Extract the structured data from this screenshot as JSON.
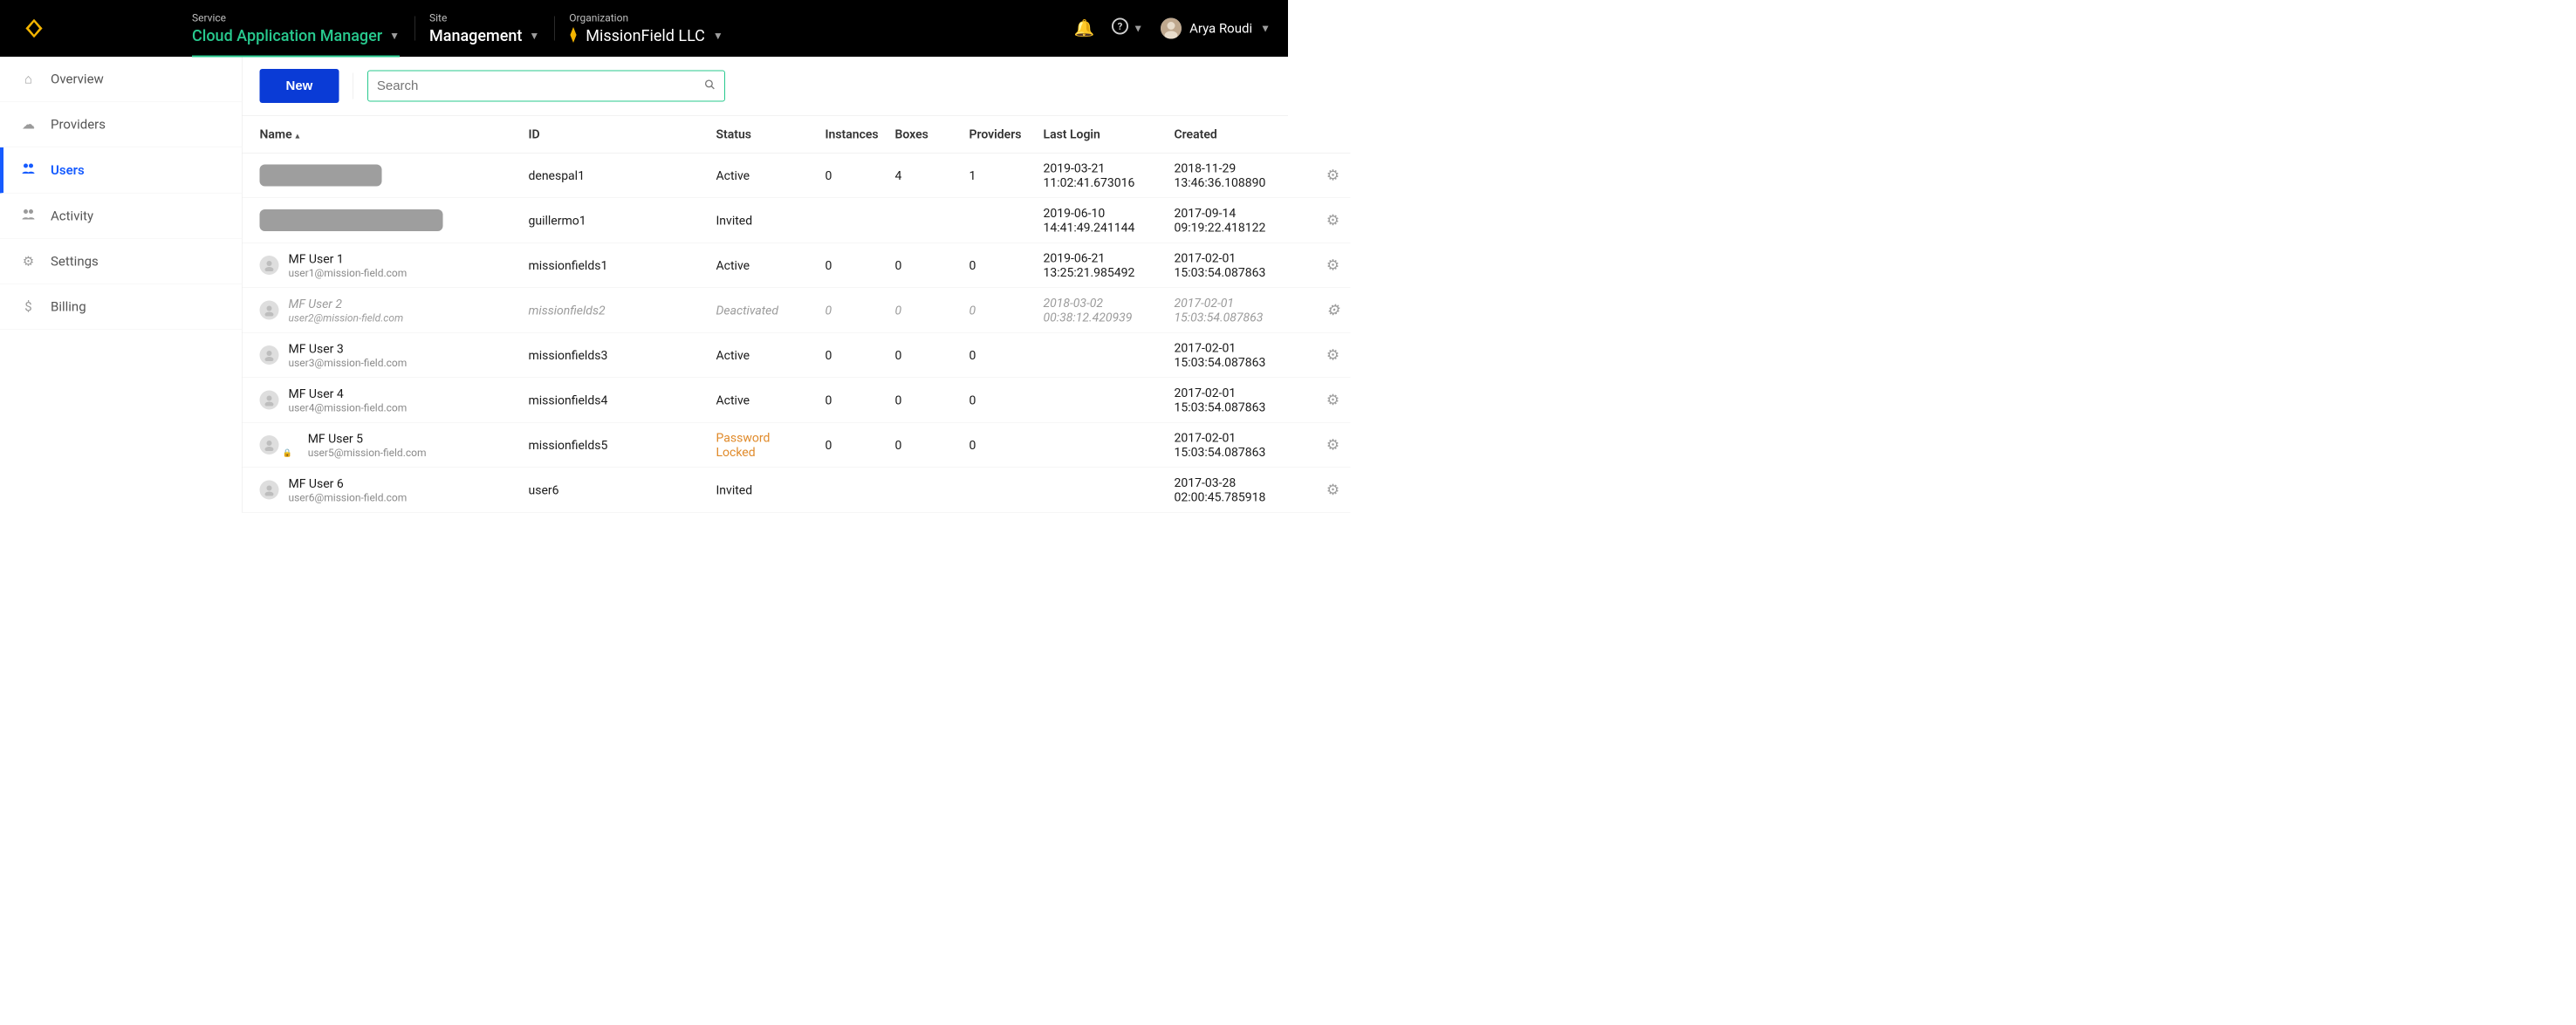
{
  "header": {
    "labels": {
      "service": "Service",
      "site": "Site",
      "organization": "Organization"
    },
    "service": "Cloud Application Manager",
    "site": "Management",
    "organization": "MissionField LLC",
    "user_name": "Arya Roudi"
  },
  "sidebar": {
    "items": [
      {
        "key": "overview",
        "label": "Overview",
        "icon": "home-icon"
      },
      {
        "key": "providers",
        "label": "Providers",
        "icon": "cloud-icon"
      },
      {
        "key": "users",
        "label": "Users",
        "icon": "users-icon"
      },
      {
        "key": "activity",
        "label": "Activity",
        "icon": "people-icon"
      },
      {
        "key": "settings",
        "label": "Settings",
        "icon": "gear-icon"
      },
      {
        "key": "billing",
        "label": "Billing",
        "icon": "dollar-icon"
      }
    ],
    "active_key": "users"
  },
  "toolbar": {
    "new_label": "New",
    "search_placeholder": "Search"
  },
  "table": {
    "columns": {
      "name": "Name",
      "id": "ID",
      "status": "Status",
      "instances": "Instances",
      "boxes": "Boxes",
      "providers": "Providers",
      "last_login": "Last Login",
      "created": "Created"
    },
    "sort": {
      "column": "name",
      "direction": "asc"
    },
    "rows": [
      {
        "redacted": true,
        "redacted_width": "narrow",
        "id": "denespal1",
        "status": "Active",
        "instances": "0",
        "boxes": "4",
        "providers": "1",
        "last_login": "2019-03-21 11:02:41.673016",
        "created": "2018-11-29 13:46:36.108890"
      },
      {
        "redacted": true,
        "redacted_width": "wide",
        "id": "guillermo1",
        "status": "Invited",
        "instances": "",
        "boxes": "",
        "providers": "",
        "last_login": "2019-06-10 14:41:49.241144",
        "created": "2017-09-14 09:19:22.418122"
      },
      {
        "name": "MF User 1",
        "email": "user1@mission-field.com",
        "id": "missionfields1",
        "status": "Active",
        "instances": "0",
        "boxes": "0",
        "providers": "0",
        "last_login": "2019-06-21 13:25:21.985492",
        "created": "2017-02-01 15:03:54.087863"
      },
      {
        "name": "MF User 2",
        "email": "user2@mission-field.com",
        "id": "missionfields2",
        "status": "Deactivated",
        "instances": "0",
        "boxes": "0",
        "providers": "0",
        "last_login": "2018-03-02 00:38:12.420939",
        "created": "2017-02-01 15:03:54.087863",
        "deactivated": true
      },
      {
        "name": "MF User 3",
        "email": "user3@mission-field.com",
        "id": "missionfields3",
        "status": "Active",
        "instances": "0",
        "boxes": "0",
        "providers": "0",
        "last_login": "",
        "created": "2017-02-01 15:03:54.087863"
      },
      {
        "name": "MF User 4",
        "email": "user4@mission-field.com",
        "id": "missionfields4",
        "status": "Active",
        "instances": "0",
        "boxes": "0",
        "providers": "0",
        "last_login": "",
        "created": "2017-02-01 15:03:54.087863"
      },
      {
        "name": "MF User 5",
        "email": "user5@mission-field.com",
        "id": "missionfields5",
        "status": "Password Locked",
        "status_warn": true,
        "locked": true,
        "instances": "0",
        "boxes": "0",
        "providers": "0",
        "last_login": "",
        "created": "2017-02-01 15:03:54.087863"
      },
      {
        "name": "MF User 6",
        "email": "user6@mission-field.com",
        "id": "user6",
        "status": "Invited",
        "instances": "",
        "boxes": "",
        "providers": "",
        "last_login": "",
        "created": "2017-03-28 02:00:45.785918"
      }
    ]
  },
  "icons": {
    "home": "⌂",
    "cloud": "☁",
    "users": "👥",
    "people": "👥",
    "gear": "⚙",
    "dollar": "$",
    "bell": "🔔",
    "help": "?",
    "caret": "▼",
    "sort_asc": "▴",
    "search": "🔍",
    "person": "👤",
    "lock": "🔒"
  }
}
